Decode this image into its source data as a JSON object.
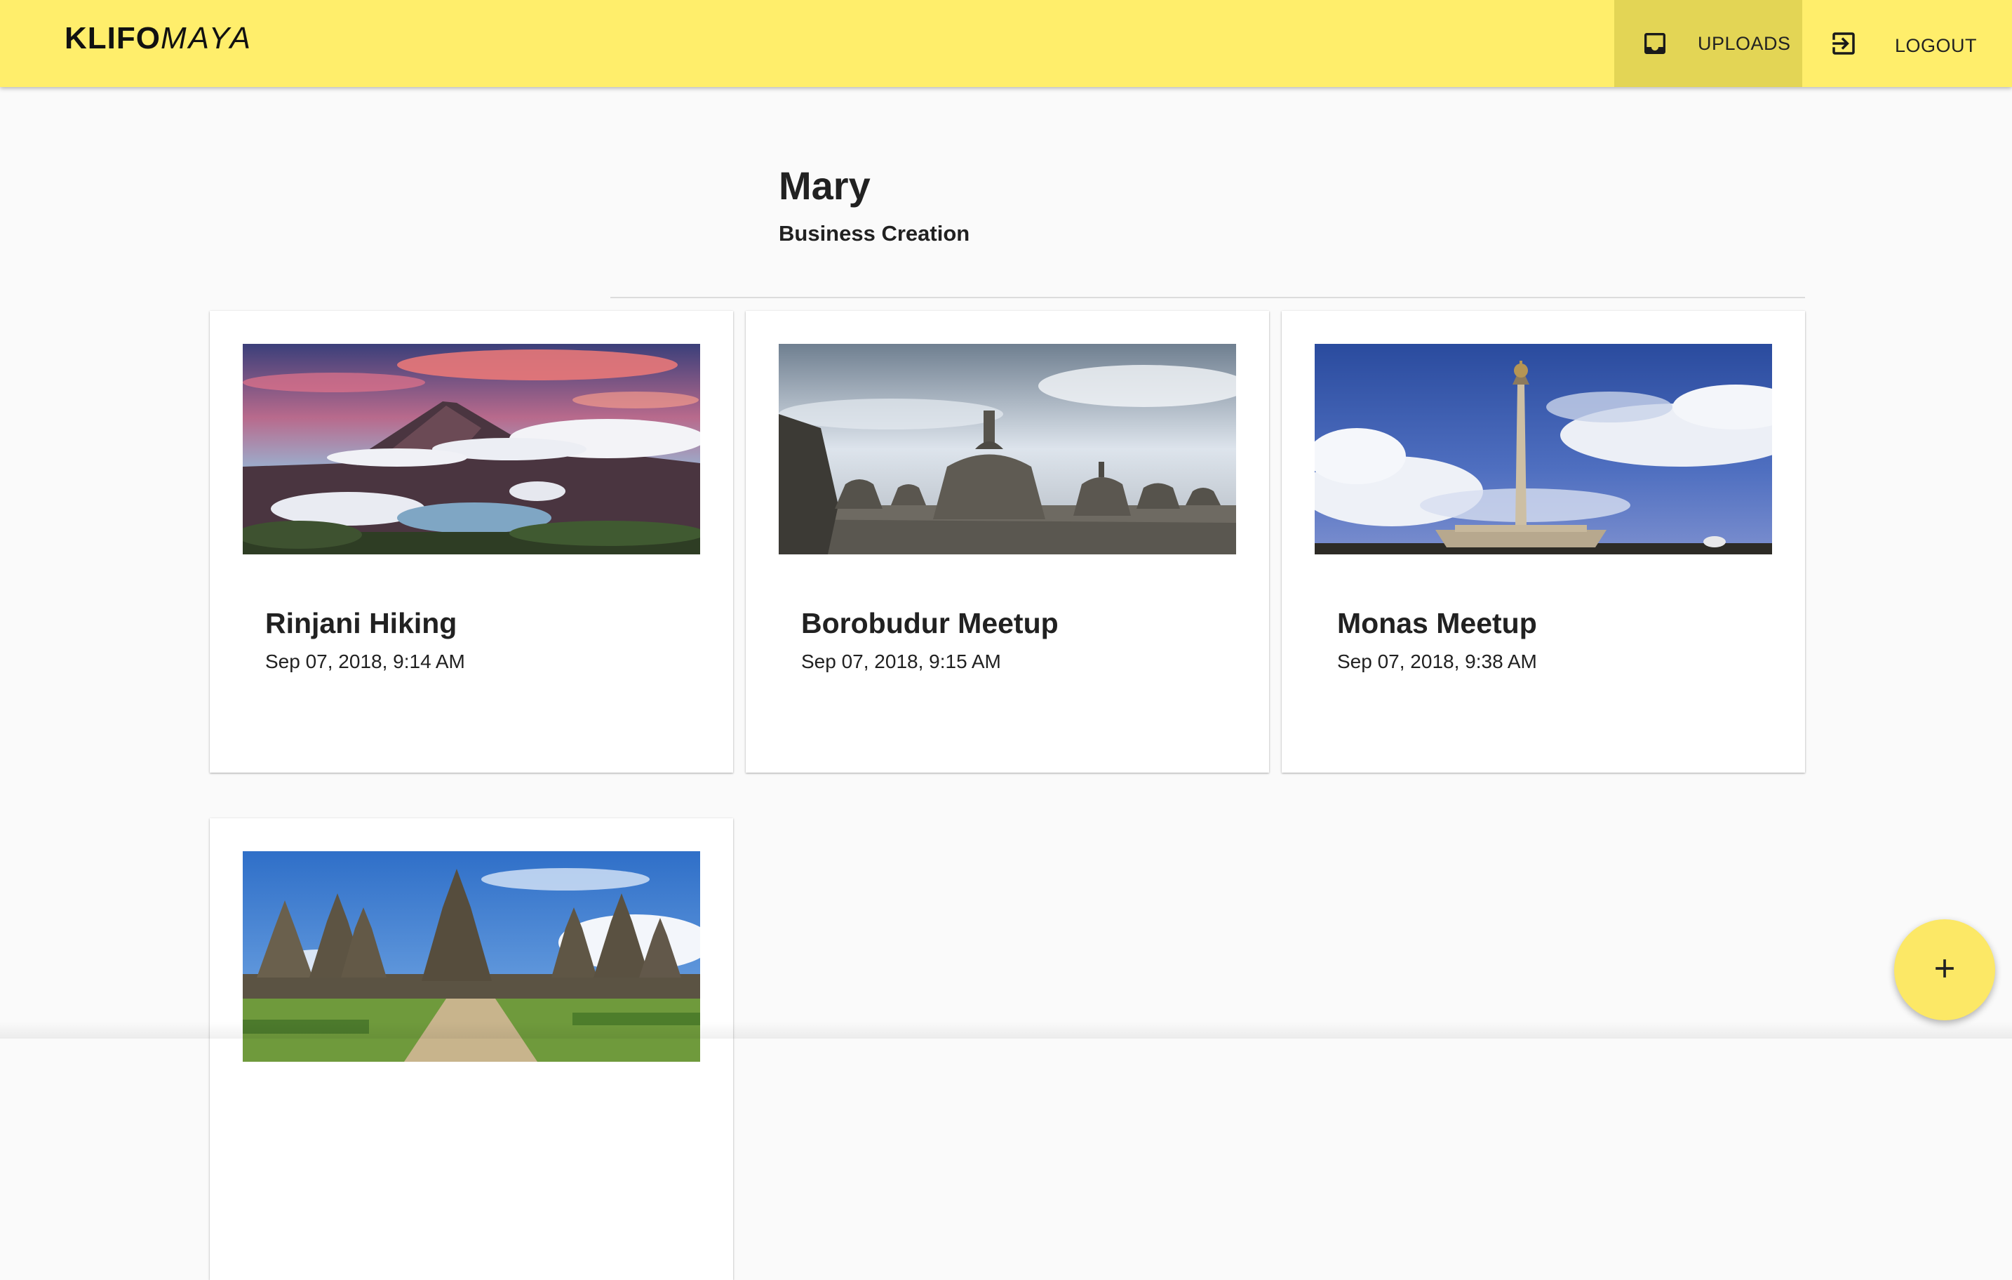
{
  "app": {
    "logo_part_1": "KLIFO",
    "logo_part_2": "MAYA",
    "accent_color": "#ffee6b"
  },
  "nav": {
    "uploads": {
      "label": "UPLOADS",
      "icon": "inbox-icon",
      "active": true
    },
    "logout": {
      "label": "LOGOUT",
      "icon": "exit-icon"
    }
  },
  "profile": {
    "name": "Mary",
    "subtitle": "Business Creation"
  },
  "events": [
    {
      "title": "Rinjani Hiking",
      "date": "Sep 07, 2018, 9:14 AM",
      "image": "mountain-lake-photo"
    },
    {
      "title": "Borobudur Meetup",
      "date": "Sep 07, 2018, 9:15 AM",
      "image": "stupa-temple-photo"
    },
    {
      "title": "Monas Meetup",
      "date": "Sep 07, 2018, 9:38 AM",
      "image": "monument-tower-photo"
    },
    {
      "title": "",
      "date": "",
      "image": "prambanan-temple-photo"
    }
  ],
  "fab": {
    "icon": "plus-icon"
  }
}
